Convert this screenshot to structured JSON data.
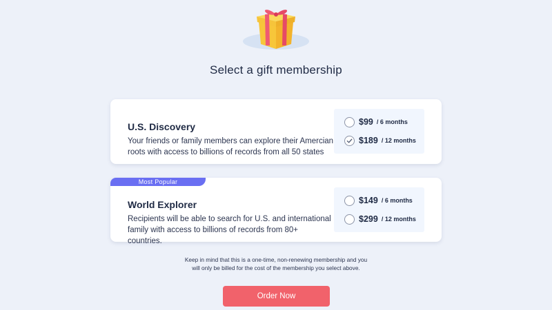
{
  "header": {
    "gift_icon": "gift-box-icon",
    "title": "Select a gift membership"
  },
  "plans": [
    {
      "name": "U.S. Discovery",
      "description_line1": "Your friends or family members can explore their Amercian",
      "description_line2": "roots with access to billions of records from all 50 states",
      "options": [
        {
          "price": "$99",
          "period": "/ 6 months",
          "selected": false
        },
        {
          "price": "$189",
          "period": "/ 12 months",
          "selected": true
        }
      ]
    },
    {
      "badge": "Most Popular",
      "name": "World Explorer",
      "description_line1": "Recipients will be able to search for U.S. and international",
      "description_line2": "family with access to billions of records from 80+ countries.",
      "options": [
        {
          "price": "$149",
          "period": "/ 6 months",
          "selected": false
        },
        {
          "price": "$299",
          "period": "/ 12 months",
          "selected": false
        }
      ]
    }
  ],
  "note": {
    "line1": "Keep in mind that this is a one-time, non-renewing membership and you",
    "line2": "will only be billed for the cost of the membership you select above."
  },
  "order_button": "Order Now",
  "colors": {
    "background": "#edf1f9",
    "accent": "#f1626b",
    "badge": "#6a6ff2",
    "text": "#1f2a44"
  }
}
